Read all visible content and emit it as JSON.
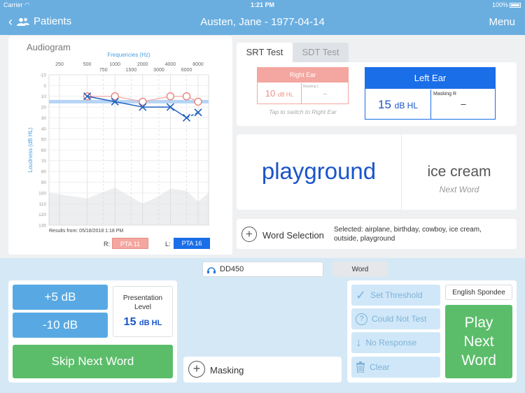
{
  "status_bar": {
    "carrier": "Carrier",
    "time": "1:21 PM",
    "battery": "100%"
  },
  "nav": {
    "back_label": "Patients",
    "title": "Austen, Jane - 1977-04-14",
    "menu_label": "Menu"
  },
  "audiogram": {
    "title": "Audiogram",
    "x_axis_label": "Frequencies (Hz)",
    "y_axis_label": "Loudness (dB HL)",
    "freq_labels_top": [
      "250",
      "500",
      "1000",
      "2000",
      "4000",
      "8000"
    ],
    "freq_labels_bottom": [
      "750",
      "1500",
      "3000",
      "6000"
    ],
    "db_labels": [
      "-10",
      "0",
      "10",
      "20",
      "30",
      "40",
      "50",
      "60",
      "70",
      "80",
      "90",
      "100",
      "110",
      "120",
      "130"
    ],
    "results_date": "Results from: 05/18/2018 1:18 PM",
    "right_label": "R:",
    "left_label": "L:",
    "pta_right": "PTA 11",
    "pta_left": "PTA 16"
  },
  "chart_data": {
    "type": "line",
    "x_unit": "Hz",
    "y_unit": "dB HL",
    "ylim": [
      -10,
      130
    ],
    "y_inverted": true,
    "series": [
      {
        "name": "Right Ear",
        "color": "#e8837a",
        "marker": "circle",
        "points": [
          [
            500,
            10
          ],
          [
            1000,
            10
          ],
          [
            2000,
            15
          ],
          [
            4000,
            10
          ],
          [
            6000,
            10
          ],
          [
            8000,
            15
          ]
        ]
      },
      {
        "name": "Left Ear",
        "color": "#2060c0",
        "marker": "x",
        "points": [
          [
            500,
            10
          ],
          [
            1000,
            15
          ],
          [
            2000,
            20
          ],
          [
            4000,
            20
          ],
          [
            6000,
            30
          ],
          [
            8000,
            25
          ]
        ]
      }
    ],
    "srt_band_db": 15
  },
  "srt": {
    "tab_srt": "SRT Test",
    "tab_sdt": "SDT Test",
    "right_ear": {
      "title": "Right Ear",
      "value": "10",
      "unit": "dB HL",
      "masking_label": "Masking L",
      "masking_value": "–",
      "hint": "Tap to switch to Right Ear"
    },
    "left_ear": {
      "title": "Left Ear",
      "value": "15",
      "unit": "dB HL",
      "masking_label": "Masking R",
      "masking_value": "–"
    }
  },
  "word_display": {
    "current_word": "playground",
    "next_word": "ice cream",
    "next_label": "Next Word"
  },
  "word_selection": {
    "label": "Word Selection",
    "selected": "Selected: airplane, birthday, cowboy, ice cream, outside, playground"
  },
  "controls": {
    "transducer": "DD450",
    "mode": "Word",
    "plus_btn": "+5 dB",
    "minus_btn": "-10 dB",
    "presentation_label": "Presentation Level",
    "presentation_value": "15",
    "presentation_unit": "dB HL",
    "skip_btn": "Skip Next Word",
    "masking_label": "Masking",
    "set_threshold": "Set Threshold",
    "could_not_test": "Could Not Test",
    "no_response": "No Response",
    "clear": "Clear",
    "word_list": "English Spondee",
    "play_btn": "Play Next Word"
  },
  "colors": {
    "nav": "#6aaee0",
    "right_ear": "#f4a7a0",
    "left_ear": "#1a6ee8",
    "green": "#5bbd6a",
    "blue_btn": "#58a9e3"
  }
}
